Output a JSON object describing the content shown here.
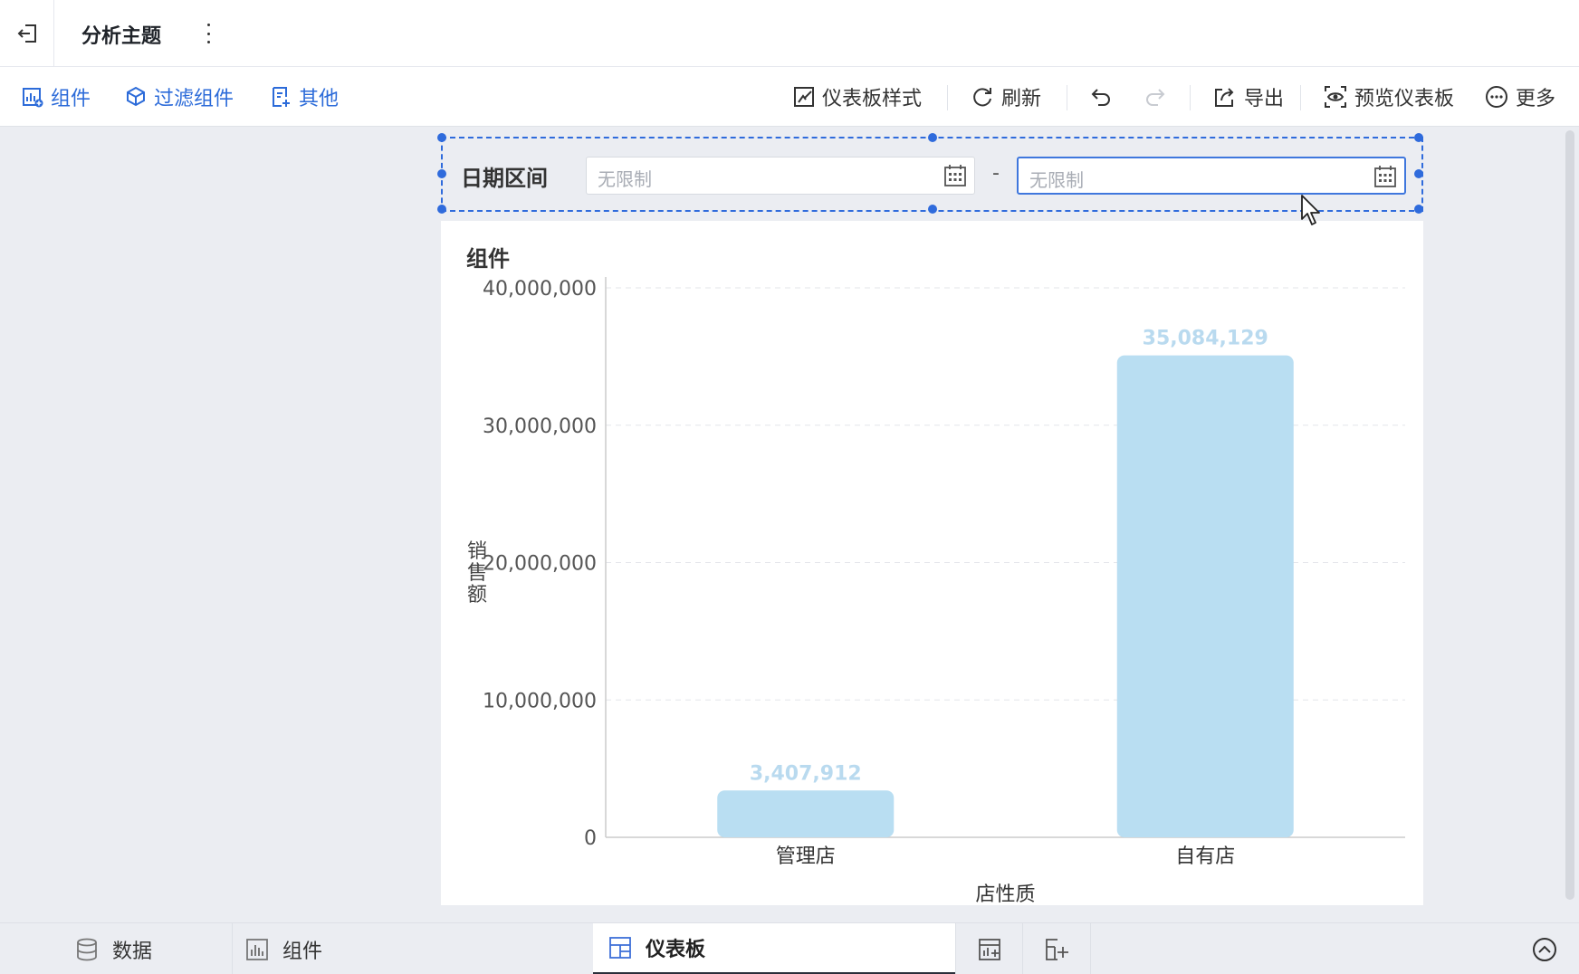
{
  "header": {
    "title": "分析主题",
    "back_icon": "exit-icon",
    "menu_icon": "kebab-icon"
  },
  "toolbar": {
    "left": [
      {
        "label": "组件",
        "icon": "add-chart-icon"
      },
      {
        "label": "过滤组件",
        "icon": "filter-cube-icon"
      },
      {
        "label": "其他",
        "icon": "add-doc-icon"
      }
    ],
    "right": [
      {
        "label": "仪表板样式",
        "icon": "style-icon"
      },
      {
        "label": "刷新",
        "icon": "refresh-icon"
      },
      {
        "label": "导出",
        "icon": "export-icon"
      },
      {
        "label": "预览仪表板",
        "icon": "preview-icon"
      },
      {
        "label": "更多",
        "icon": "more-icon"
      }
    ],
    "undo_icon": "undo-icon",
    "redo_icon": "redo-icon"
  },
  "filter": {
    "label": "日期区间",
    "start_placeholder": "无限制",
    "end_placeholder": "无限制",
    "separator": "-"
  },
  "chart_card": {
    "title": "组件"
  },
  "chart_data": {
    "type": "bar",
    "categories": [
      "管理店",
      "自有店"
    ],
    "values": [
      3407912,
      35084129
    ],
    "value_labels": [
      "3,407,912",
      "35,084,129"
    ],
    "xlabel": "店性质",
    "ylabel": "销售额",
    "ylim": [
      0,
      40000000
    ],
    "yticks": [
      0,
      10000000,
      20000000,
      30000000,
      40000000
    ],
    "ytick_labels": [
      "0",
      "10,000,000",
      "20,000,000",
      "30,000,000",
      "40,000,000"
    ],
    "bar_color": "#b9def2",
    "label_color": "#b9daef",
    "grid": true
  },
  "bottom_tabs": [
    {
      "label": "数据",
      "icon": "database-icon"
    },
    {
      "label": "组件",
      "icon": "bar-chart-icon"
    },
    {
      "label": "仪表板",
      "icon": "dashboard-icon"
    }
  ],
  "bottom_actions": [
    "add-component-icon",
    "add-dashboard-icon",
    "collapse-up-icon"
  ],
  "colors": {
    "accent": "#2c6bd9",
    "selection": "#2f6bdc"
  }
}
